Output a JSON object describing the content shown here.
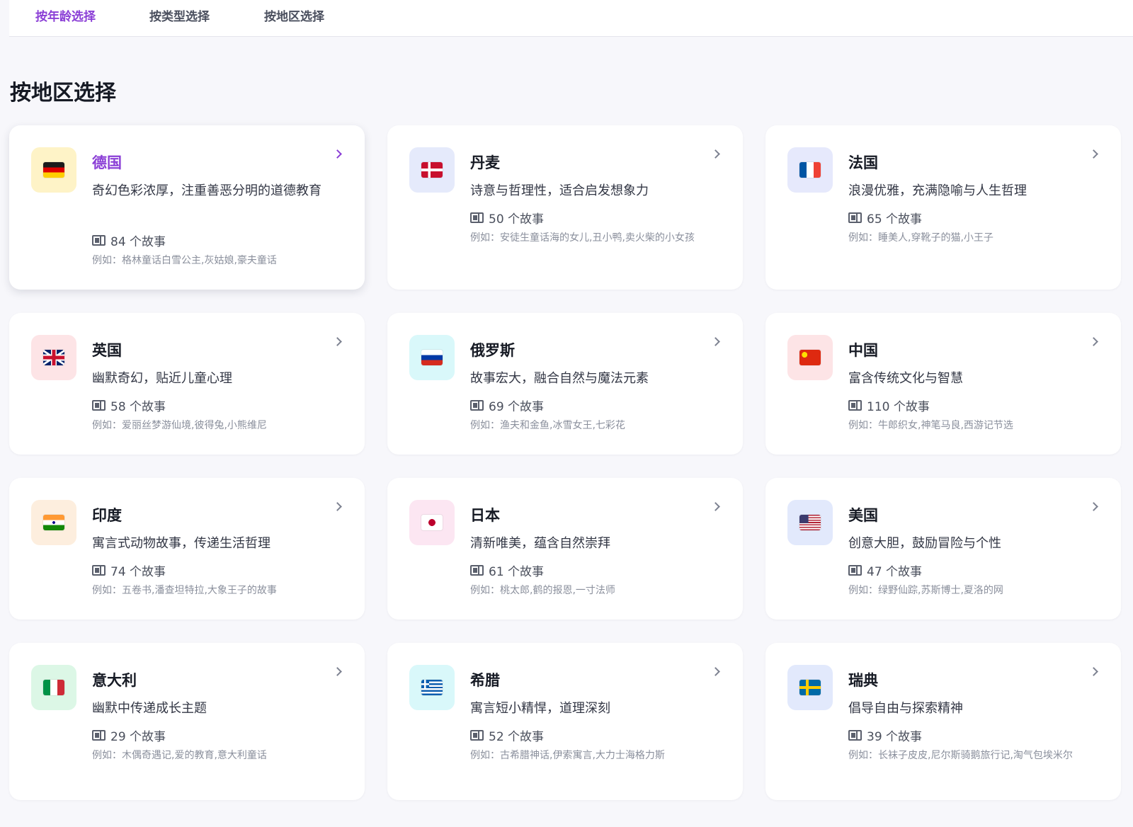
{
  "tabs": [
    {
      "label": "按年龄选择",
      "active": true
    },
    {
      "label": "按类型选择",
      "active": false
    },
    {
      "label": "按地区选择",
      "active": false
    }
  ],
  "section_title": "按地区选择",
  "example_prefix": "例如：",
  "count_suffix": " 个故事",
  "regions": [
    {
      "name": "德国",
      "description": "奇幻色彩浓厚，注重善恶分明的道德教育",
      "count": 84,
      "examples": "格林童话白雪公主,灰姑娘,豪夫童话",
      "flag": "germany-flag-icon",
      "tint": "#fef3c7",
      "active": true
    },
    {
      "name": "丹麦",
      "description": "诗意与哲理性，适合启发想象力",
      "count": 50,
      "examples": "安徒生童话海的女儿,丑小鸭,卖火柴的小女孩",
      "flag": "denmark-flag-icon",
      "tint": "#e5eafb"
    },
    {
      "name": "法国",
      "description": "浪漫优雅，充满隐喻与人生哲理",
      "count": 65,
      "examples": "睡美人,穿靴子的猫,小王子",
      "flag": "france-flag-icon",
      "tint": "#e6e9fc"
    },
    {
      "name": "英国",
      "description": "幽默奇幻，贴近儿童心理",
      "count": 58,
      "examples": "爱丽丝梦游仙境,彼得兔,小熊维尼",
      "flag": "uk-flag-icon",
      "tint": "#fde4e6"
    },
    {
      "name": "俄罗斯",
      "description": "故事宏大，融合自然与魔法元素",
      "count": 69,
      "examples": "渔夫和金鱼,冰雪女王,七彩花",
      "flag": "russia-flag-icon",
      "tint": "#d9f8fa"
    },
    {
      "name": "中国",
      "description": "富含传统文化与智慧",
      "count": 110,
      "examples": "牛郎织女,神笔马良,西游记节选",
      "flag": "china-flag-icon",
      "tint": "#fde4e6"
    },
    {
      "name": "印度",
      "description": "寓言式动物故事，传递生活哲理",
      "count": 74,
      "examples": "五卷书,潘查坦特拉,大象王子的故事",
      "flag": "india-flag-icon",
      "tint": "#fdeede"
    },
    {
      "name": "日本",
      "description": "清新唯美，蕴含自然崇拜",
      "count": 61,
      "examples": "桃太郎,鹤的报恩,一寸法师",
      "flag": "japan-flag-icon",
      "tint": "#fce6f2"
    },
    {
      "name": "美国",
      "description": "创意大胆，鼓励冒险与个性",
      "count": 47,
      "examples": "绿野仙踪,苏斯博士,夏洛的网",
      "flag": "usa-flag-icon",
      "tint": "#e2e9fc"
    },
    {
      "name": "意大利",
      "description": "幽默中传递成长主题",
      "count": 29,
      "examples": "木偶奇遇记,爱的教育,意大利童话",
      "flag": "italy-flag-icon",
      "tint": "#dcf7e6"
    },
    {
      "name": "希腊",
      "description": "寓言短小精悍，道理深刻",
      "count": 52,
      "examples": "古希腊神话,伊索寓言,大力士海格力斯",
      "flag": "greece-flag-icon",
      "tint": "#d9f8fa"
    },
    {
      "name": "瑞典",
      "description": "倡导自由与探索精神",
      "count": 39,
      "examples": "长袜子皮皮,尼尔斯骑鹅旅行记,淘气包埃米尔",
      "flag": "sweden-flag-icon",
      "tint": "#e2e9fc"
    }
  ]
}
